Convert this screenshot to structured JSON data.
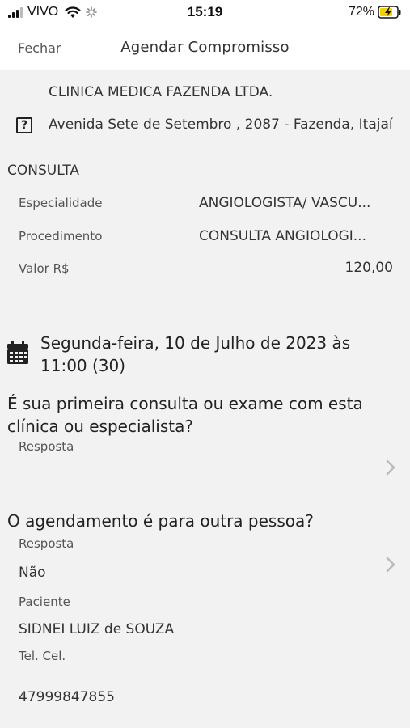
{
  "status_bar": {
    "carrier": "VIVO",
    "time": "15:19",
    "battery": "72%",
    "icons": [
      "signal-icon",
      "wifi-icon",
      "loading-icon",
      "battery-charging-icon"
    ]
  },
  "nav": {
    "close_label": "Fechar",
    "title": "Agendar Compromisso"
  },
  "clinic": {
    "name": "CLINICA MEDICA FAZENDA LTDA.",
    "help_glyph": "?",
    "address": "Avenida Sete de Setembro , 2087 - Fazenda, Itajaí"
  },
  "consulta": {
    "section_title": "CONSULTA",
    "rows": [
      {
        "label": "Especialidade",
        "value": "ANGIOLOGISTA/ VASCU..."
      },
      {
        "label": "Procedimento",
        "value": "CONSULTA ANGIOLOGI..."
      },
      {
        "label": "Valor R$",
        "value": "120,00"
      }
    ]
  },
  "appointment": {
    "datetime_line1": "Segunda-feira, 10 de Julho de 2023 às",
    "datetime_line2": "11:00 (30)"
  },
  "first_visit": {
    "question": "É sua primeira consulta ou exame com esta clínica ou especialista?",
    "answer_label": "Resposta",
    "answer_value": ""
  },
  "other_person": {
    "question": "O agendamento é para outra pessoa?",
    "answer_label": "Resposta",
    "answer_value": "Não",
    "patient_label": "Paciente",
    "patient_value": "SIDNEI LUIZ de SOUZA",
    "phone_label": "Tel. Cel.",
    "phone_value": "47999847855"
  },
  "colors": {
    "background": "#f2f2f2",
    "bar_background": "#ffffff",
    "text": "#333333",
    "secondary_text": "#555555",
    "chevron": "#bbbbbb",
    "battery_fill": "#f5d000"
  }
}
